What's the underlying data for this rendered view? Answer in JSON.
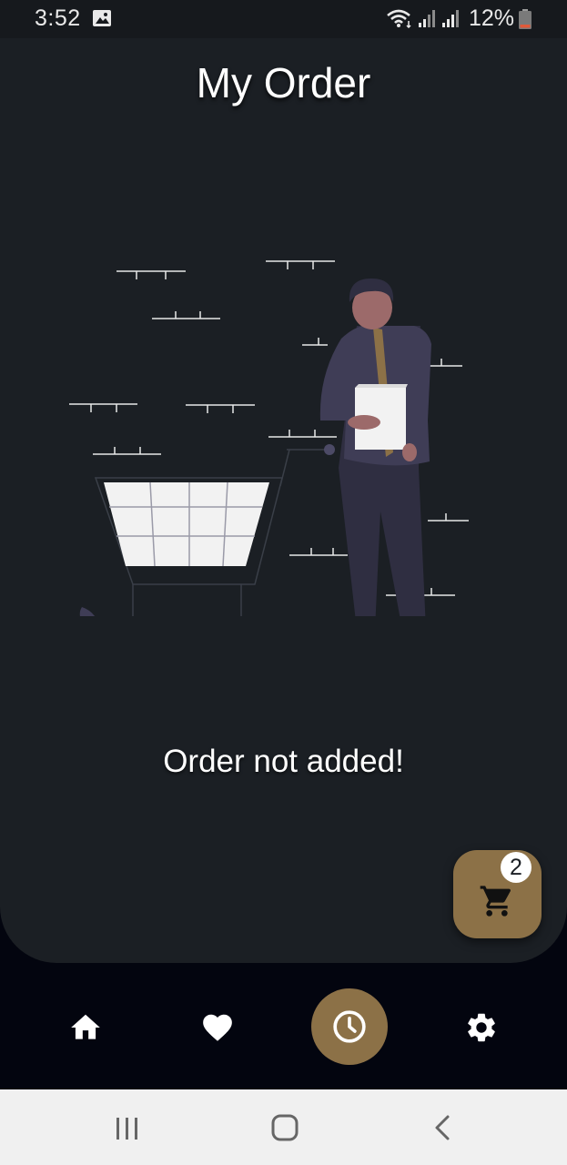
{
  "status_bar": {
    "time": "3:52",
    "battery_percent": "12%",
    "icons": [
      "gallery-icon",
      "wifi-icon",
      "signal-icon",
      "signal-icon",
      "battery-low-icon"
    ]
  },
  "page": {
    "title": "My Order",
    "empty_message": "Order not added!",
    "illustration": "empty-cart-illustration"
  },
  "cart_fab": {
    "icon": "shopping-cart-icon",
    "badge_count": "2"
  },
  "bottom_nav": {
    "items": [
      {
        "icon": "home-icon",
        "active": false
      },
      {
        "icon": "heart-icon",
        "active": false
      },
      {
        "icon": "clock-icon",
        "active": true
      },
      {
        "icon": "gear-icon",
        "active": false
      }
    ]
  },
  "system_nav": {
    "buttons": [
      "recents-icon",
      "home-button-icon",
      "back-icon"
    ]
  },
  "colors": {
    "card_background": "#1b1f24",
    "app_background": "#03050f",
    "accent": "#8c7147",
    "text": "#ffffff"
  }
}
